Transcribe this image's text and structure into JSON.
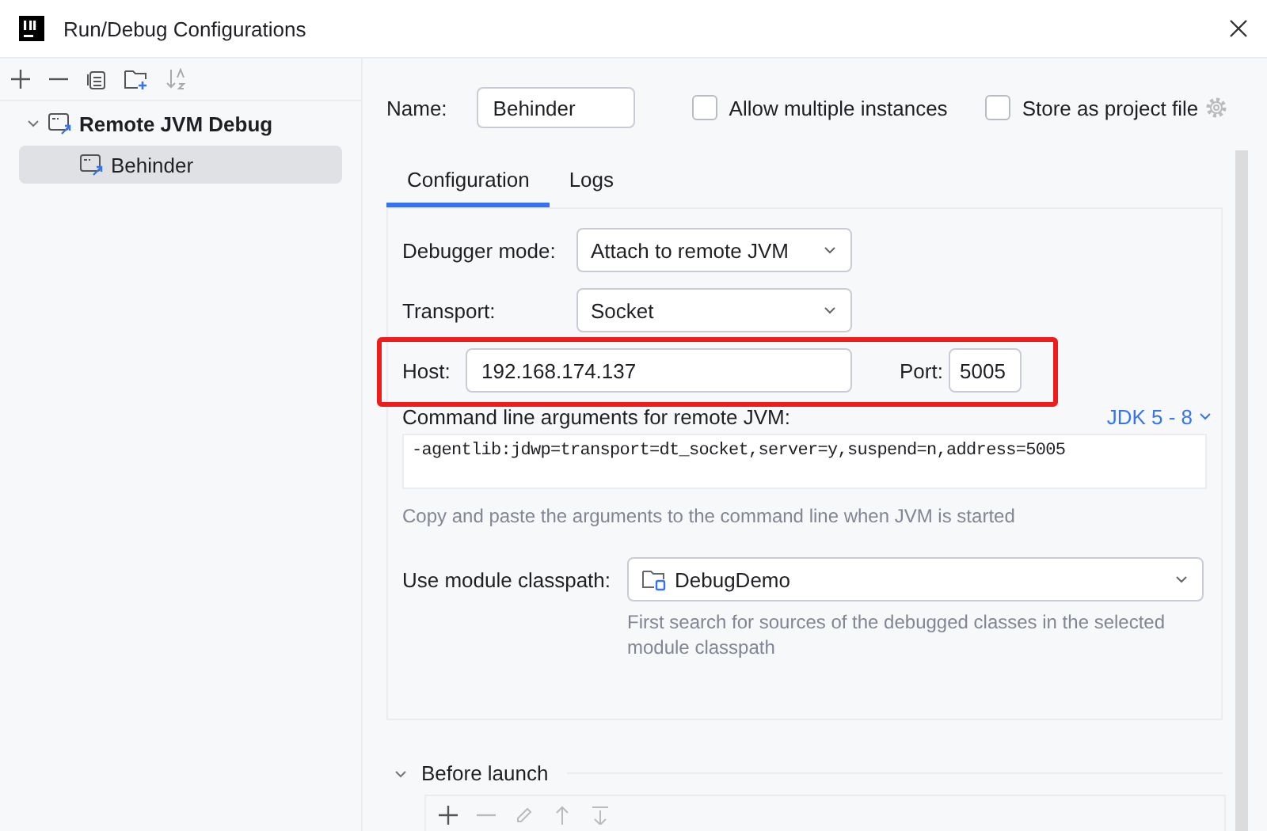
{
  "window": {
    "title": "Run/Debug Configurations"
  },
  "tree": [
    {
      "label": "Remote JVM Debug",
      "expanded": true,
      "selected": false,
      "children": [
        {
          "label": "Behinder",
          "selected": true
        }
      ]
    }
  ],
  "name_field": {
    "label": "Name:",
    "value": "Behinder"
  },
  "checkboxes": [
    {
      "label": "Allow multiple instances",
      "checked": false
    },
    {
      "label": "Store as project file",
      "checked": false
    }
  ],
  "tabs": [
    {
      "label": "Configuration",
      "selected": true
    },
    {
      "label": "Logs",
      "selected": false
    }
  ],
  "debugger_mode": {
    "label": "Debugger mode:",
    "value": "Attach to remote JVM"
  },
  "transport": {
    "label": "Transport:",
    "value": "Socket"
  },
  "host": {
    "label": "Host:",
    "value": "192.168.174.137",
    "highlighted": true
  },
  "port": {
    "label": "Port:",
    "value": "5005"
  },
  "command_line": {
    "label": "Command line arguments for remote JVM:",
    "jdk": "JDK 5 - 8",
    "value": "-agentlib:jdwp=transport=dt_socket,server=y,suspend=n,address=5005",
    "hint": "Copy and paste the arguments to the command line when JVM is started"
  },
  "module_classpath": {
    "label": "Use module classpath:",
    "value": "DebugDemo",
    "hint": "First search for sources of the debugged classes in the selected module classpath"
  },
  "before_launch": {
    "label": "Before launch",
    "expanded": true
  }
}
